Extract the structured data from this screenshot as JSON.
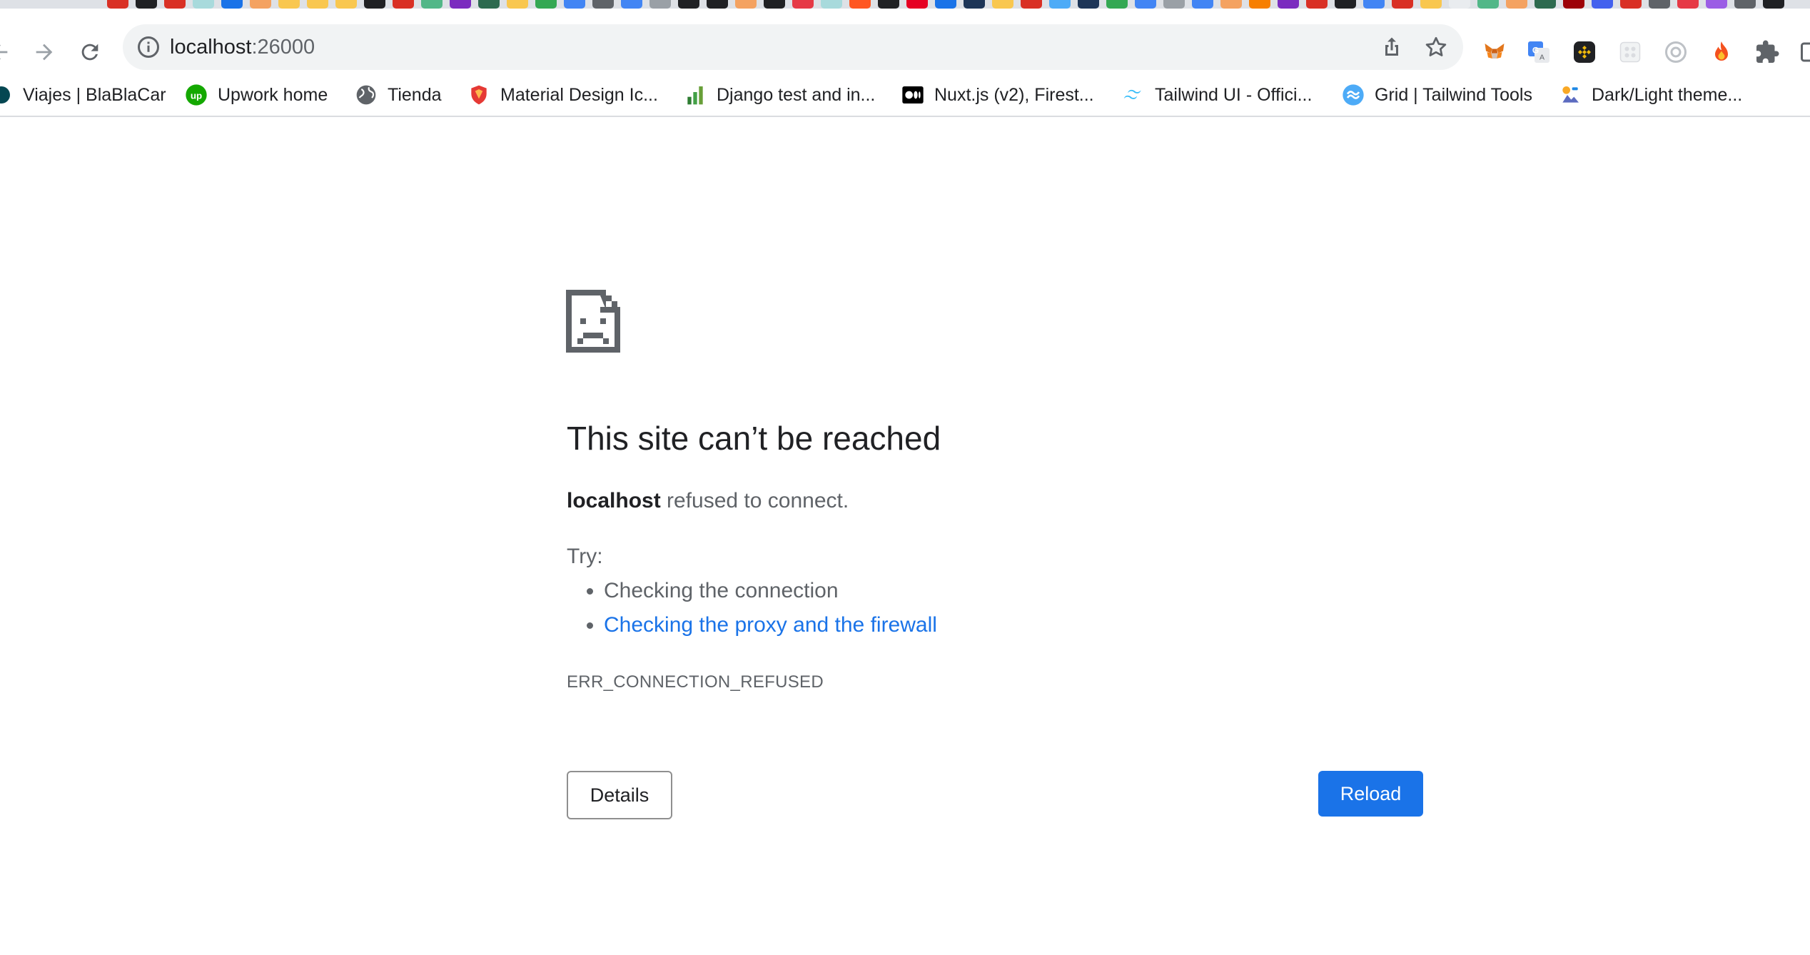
{
  "browser": {
    "address_bar": {
      "host": "localhost",
      "port": ":26000"
    },
    "bookmarks": [
      {
        "label": "Viajes | BlaBlaCar",
        "icon": "blablacar-icon"
      },
      {
        "label": "Upwork home",
        "icon": "upwork-icon"
      },
      {
        "label": "Tienda",
        "icon": "globe-icon"
      },
      {
        "label": "Material Design Ic...",
        "icon": "shield-icon"
      },
      {
        "label": "Django test and in...",
        "icon": "bar-chart-icon"
      },
      {
        "label": "Nuxt.js (v2), Firest...",
        "icon": "medium-icon"
      },
      {
        "label": "Tailwind UI - Offici...",
        "icon": "tailwind-icon"
      },
      {
        "label": "Grid | Tailwind Tools",
        "icon": "grid-tools-icon"
      },
      {
        "label": "Dark/Light theme...",
        "icon": "theme-icon"
      }
    ],
    "extensions": [
      "metamask-icon",
      "google-translate-icon",
      "binance-icon",
      "extension-grid-icon",
      "circle-extension-icon",
      "fire-icon",
      "puzzle-icon"
    ],
    "colors": {
      "accent": "#1a73e8",
      "toolbar_bg": "#ffffff",
      "omnibox_bg": "#f1f3f4"
    }
  },
  "error_page": {
    "title": "This site can’t be reached",
    "host": "localhost",
    "message": " refused to connect.",
    "try_label": "Try:",
    "suggestions": [
      {
        "text": "Checking the connection"
      },
      {
        "text": "Checking the proxy and the firewall"
      }
    ],
    "error_code": "ERR_CONNECTION_REFUSED",
    "details_button": "Details",
    "reload_button": "Reload"
  }
}
